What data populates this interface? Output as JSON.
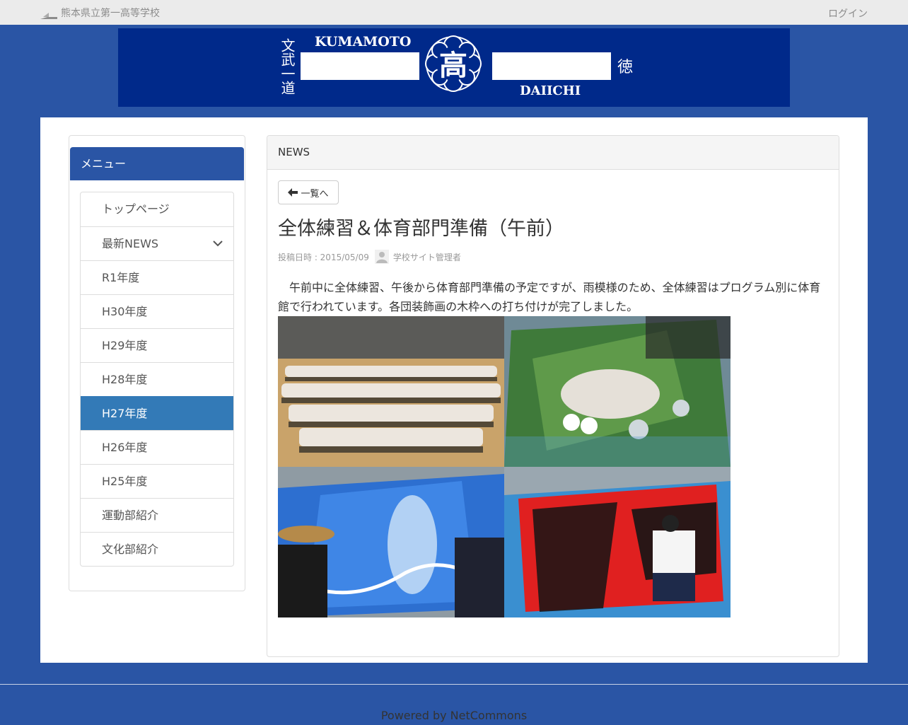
{
  "header": {
    "site_name": "熊本県立第一高等学校",
    "login_label": "ログイン"
  },
  "banner": {
    "text_top_left": "KUMAMOTO",
    "text_bottom_right": "DAIICHI",
    "center_char": "高",
    "left_vertical": "文武一道",
    "right_vertical": "徳"
  },
  "sidebar": {
    "menu_title": "メニュー",
    "items": [
      {
        "label": "トップページ"
      },
      {
        "label": "最新NEWS"
      },
      {
        "label": "R1年度"
      },
      {
        "label": "H30年度"
      },
      {
        "label": "H29年度"
      },
      {
        "label": "H28年度"
      },
      {
        "label": "H27年度"
      },
      {
        "label": "H26年度"
      },
      {
        "label": "H25年度"
      },
      {
        "label": "運動部紹介"
      },
      {
        "label": "文化部紹介"
      }
    ],
    "active_item": "H27年度"
  },
  "news": {
    "panel_title": "NEWS",
    "back_label": "一覧へ",
    "title": "全体練習＆体育部門準備（午前）",
    "posted_label": "投稿日時 : 2015/05/09",
    "author": "学校サイト管理者",
    "body": "　午前中に全体練習、午後から体育部門準備の予定ですが、雨模様のため、全体練習はプログラム別に体育館で行われています。各団装飾画の木枠への打ち付けが完了しました。"
  },
  "footer": {
    "powered": "Powered by NetCommons"
  },
  "colors": {
    "page_bg": "#2a55a5",
    "banner_bg": "#00298a",
    "active_item": "#337ab7"
  }
}
